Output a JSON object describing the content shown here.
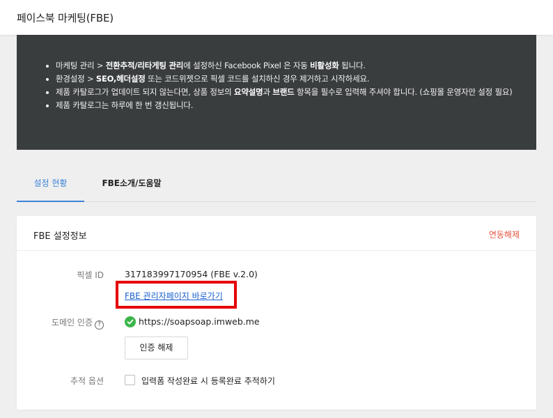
{
  "header": {
    "title": "페이스북 마케팅(FBE)"
  },
  "notice": {
    "items": [
      {
        "pre": "마케팅 관리 > ",
        "bold": "전환추적/리타게팅 관리",
        "post": "에 설정하신 Facebook Pixel 은 자동 ",
        "bold2": "비활성화",
        "post2": " 됩니다."
      },
      {
        "pre": "환경설정 > ",
        "bold": "SEO,헤더설정",
        "post": " 또는 코드위젯으로 픽셀 코드를 설치하신 경우 제거하고 시작하세요.",
        "bold2": "",
        "post2": ""
      },
      {
        "pre": "제품 카탈로그가 업데이트 되지 않는다면, 상품 정보의 ",
        "bold": "요약설명",
        "post": "과 ",
        "bold2": "브랜드",
        "post2": " 항목을 필수로 입력해 주셔야 합니다. (쇼핑몰 운영자만 설정 필요)"
      },
      {
        "pre": "제품 카탈로그는 하루에 한 번 갱신됩니다.",
        "bold": "",
        "post": "",
        "bold2": "",
        "post2": ""
      }
    ]
  },
  "tabs": [
    {
      "label": "설정 현황",
      "active": true
    },
    {
      "label": "FBE소개/도움말",
      "active": false
    }
  ],
  "card": {
    "title": "FBE 설정정보",
    "unlink_label": "연동해제",
    "pixel": {
      "label": "픽셀 ID",
      "value": "317183997170954 (FBE v.2.0)",
      "link": "FBE 관리자페이지 바로가기"
    },
    "domain": {
      "label": "도메인 인증",
      "help": "?",
      "value": "https://soapsoap.imweb.me",
      "button": "인증 해제"
    },
    "tracking": {
      "label": "추적 옵션",
      "checkbox_label": "입력폼 작성완료 시 등록완료 추적하기",
      "checked": false
    }
  },
  "colors": {
    "accent": "#3b82d6",
    "danger": "#e5533d",
    "notice_bg": "#3a3d3e",
    "success": "#3bb54a",
    "highlight": "#e50000"
  }
}
